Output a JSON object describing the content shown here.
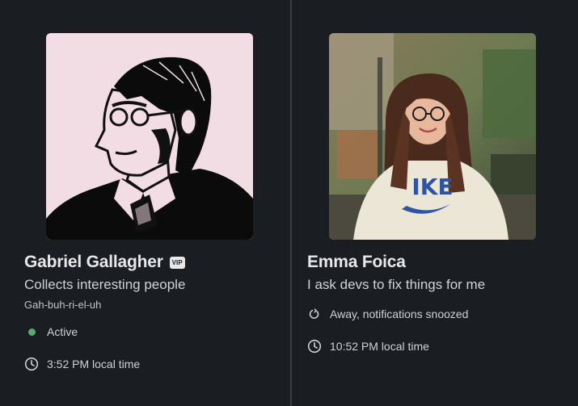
{
  "colors": {
    "background": "#1a1d21",
    "active_status": "#5aaa6b"
  },
  "profiles": [
    {
      "name": "Gabriel Gallagher",
      "badge": "VIP",
      "title": "Collects interesting people",
      "pronunciation": "Gah-buh-ri-el-uh",
      "status": {
        "icon": "green-dot-icon",
        "text": "Active"
      },
      "local_time": {
        "icon": "clock-icon",
        "text": "3:52 PM local time"
      }
    },
    {
      "name": "Emma Foica",
      "title": "I ask devs to fix things for me",
      "status": {
        "icon": "snooze-icon",
        "text": "Away, notifications snoozed"
      },
      "local_time": {
        "icon": "clock-icon",
        "text": "10:52 PM local time"
      }
    }
  ]
}
